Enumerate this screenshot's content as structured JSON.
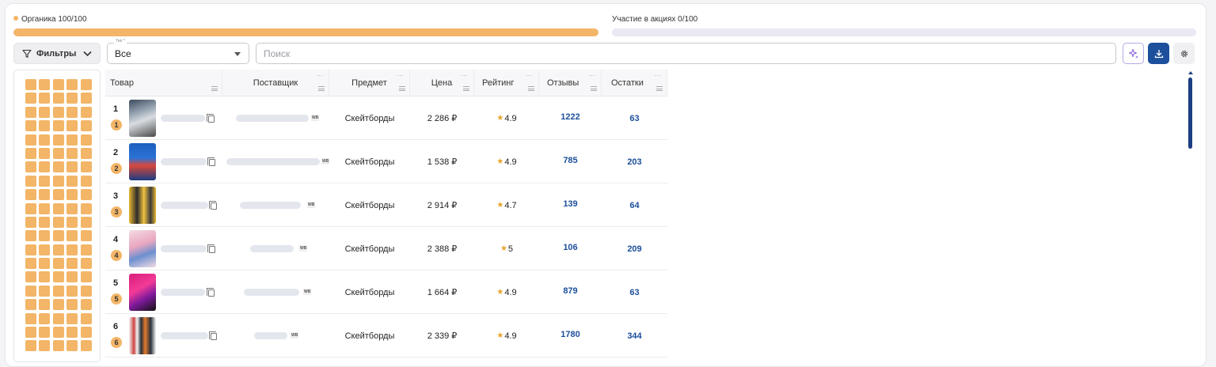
{
  "progress": {
    "organic": {
      "label": "Органика 100/100",
      "value": 100,
      "max": 100,
      "color": "#f3b567"
    },
    "promo": {
      "label": "Участие в акциях 0/100",
      "value": 0,
      "max": 100
    }
  },
  "toolbar": {
    "filters_label": "Фильтры",
    "type_float_label": "Тип *",
    "type_value": "Все",
    "search_placeholder": "Поиск",
    "icons": [
      "filter-icon",
      "chevron-down-icon",
      "sparkle-icon",
      "download-icon",
      "gear-icon"
    ]
  },
  "sidebar": {
    "cells": 100
  },
  "table": {
    "columns": [
      "Товар",
      "Поставщик",
      "Предмет",
      "Цена",
      "Рейтинг",
      "Отзывы",
      "Остатки"
    ],
    "rows": [
      {
        "rank": "1",
        "badge": "1",
        "subject": "Скейтборды",
        "price": "2 286 ₽",
        "rating": "4.9",
        "reviews": "1222",
        "stock": "63"
      },
      {
        "rank": "2",
        "badge": "2",
        "subject": "Скейтборды",
        "price": "1 538 ₽",
        "rating": "4.9",
        "reviews": "785",
        "stock": "203"
      },
      {
        "rank": "3",
        "badge": "3",
        "subject": "Скейтборды",
        "price": "2 914 ₽",
        "rating": "4.7",
        "reviews": "139",
        "stock": "64"
      },
      {
        "rank": "4",
        "badge": "4",
        "subject": "Скейтборды",
        "price": "2 388 ₽",
        "rating": "5",
        "reviews": "106",
        "stock": "209"
      },
      {
        "rank": "5",
        "badge": "5",
        "subject": "Скейтборды",
        "price": "1 664 ₽",
        "rating": "4.9",
        "reviews": "879",
        "stock": "63"
      },
      {
        "rank": "6",
        "badge": "6",
        "subject": "Скейтборды",
        "price": "2 339 ₽",
        "rating": "4.9",
        "reviews": "1780",
        "stock": "344"
      }
    ],
    "wb_tag": "WB",
    "accent_color": "#1c4f9c"
  }
}
